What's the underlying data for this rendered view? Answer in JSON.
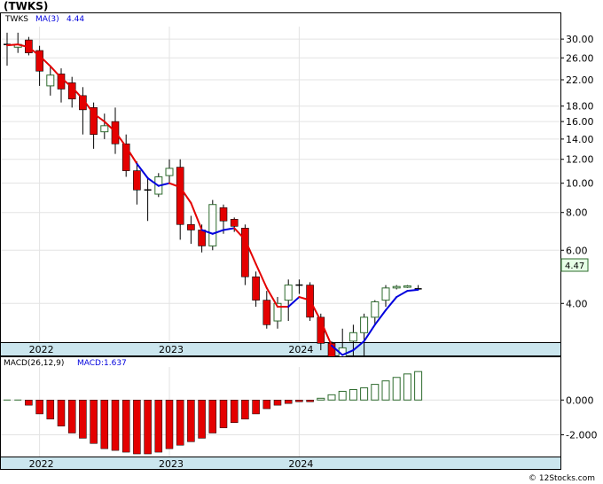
{
  "title": "(TWKS)",
  "price_panel": {
    "ticker_label": "TWKS",
    "ma_label": "MA(3)",
    "ma_value": "4.44",
    "last_price_badge": "4.47",
    "y_ticks": [
      "30.00",
      "26.00",
      "22.00",
      "18.00",
      "16.00",
      "14.00",
      "12.00",
      "10.00",
      "8.00",
      "6.00",
      "4.00"
    ],
    "x_ticks": [
      "2022",
      "2023",
      "2024"
    ]
  },
  "macd_panel": {
    "label": "MACD(26,12,9)",
    "value_label": "MACD:1.637",
    "y_ticks": [
      "0.000",
      "-2.000"
    ],
    "x_ticks": [
      "2022",
      "2023",
      "2024"
    ]
  },
  "watermark": "© 12Stocks.com",
  "colors": {
    "down": "#e40000",
    "up_fill": "#ffffff",
    "up_border": "#2e6b2e",
    "ma_down": "#e40000",
    "ma_up": "#0000dd",
    "macd_neg": "#e40000",
    "macd_pos": "#2e6b2e",
    "axis_band": "#cbe6ee",
    "badge_bg": "#e6ffe6"
  },
  "chart_data": {
    "type": "candlestick",
    "scale": "log",
    "ylim": [
      3.1,
      33
    ],
    "candles": [
      {
        "o": 28.6,
        "h": 31.5,
        "l": 24.5,
        "c": 28.8,
        "dir": "flat"
      },
      {
        "o": 28.2,
        "h": 31.5,
        "l": 27.0,
        "c": 28.8,
        "dir": "up"
      },
      {
        "o": 29.8,
        "h": 30.5,
        "l": 26.5,
        "c": 27.0,
        "dir": "down"
      },
      {
        "o": 27.5,
        "h": 28.5,
        "l": 21.0,
        "c": 23.5,
        "dir": "down"
      },
      {
        "o": 21.0,
        "h": 24.5,
        "l": 19.5,
        "c": 22.8,
        "dir": "up"
      },
      {
        "o": 23.0,
        "h": 24.0,
        "l": 18.5,
        "c": 20.5,
        "dir": "down"
      },
      {
        "o": 21.5,
        "h": 22.5,
        "l": 17.8,
        "c": 19.0,
        "dir": "down"
      },
      {
        "o": 19.5,
        "h": 20.8,
        "l": 14.5,
        "c": 17.5,
        "dir": "down"
      },
      {
        "o": 17.8,
        "h": 18.5,
        "l": 13.0,
        "c": 14.5,
        "dir": "down"
      },
      {
        "o": 14.8,
        "h": 17.0,
        "l": 14.0,
        "c": 15.5,
        "dir": "up"
      },
      {
        "o": 16.0,
        "h": 17.8,
        "l": 12.5,
        "c": 13.5,
        "dir": "down"
      },
      {
        "o": 13.5,
        "h": 14.5,
        "l": 10.5,
        "c": 11.0,
        "dir": "down"
      },
      {
        "o": 11.0,
        "h": 11.8,
        "l": 8.5,
        "c": 9.5,
        "dir": "down"
      },
      {
        "o": 9.5,
        "h": 10.5,
        "l": 7.5,
        "c": 9.5,
        "dir": "flat"
      },
      {
        "o": 9.2,
        "h": 10.8,
        "l": 9.0,
        "c": 10.5,
        "dir": "up"
      },
      {
        "o": 10.6,
        "h": 12.0,
        "l": 10.0,
        "c": 11.2,
        "dir": "up"
      },
      {
        "o": 11.3,
        "h": 12.0,
        "l": 6.5,
        "c": 7.3,
        "dir": "down"
      },
      {
        "o": 7.3,
        "h": 7.8,
        "l": 6.3,
        "c": 7.0,
        "dir": "down"
      },
      {
        "o": 7.0,
        "h": 7.3,
        "l": 5.9,
        "c": 6.2,
        "dir": "down"
      },
      {
        "o": 6.2,
        "h": 8.8,
        "l": 6.0,
        "c": 8.5,
        "dir": "up"
      },
      {
        "o": 8.3,
        "h": 8.5,
        "l": 6.8,
        "c": 7.5,
        "dir": "down"
      },
      {
        "o": 7.6,
        "h": 7.7,
        "l": 6.9,
        "c": 7.2,
        "dir": "down"
      },
      {
        "o": 7.1,
        "h": 7.3,
        "l": 4.6,
        "c": 4.9,
        "dir": "down"
      },
      {
        "o": 4.9,
        "h": 5.1,
        "l": 3.9,
        "c": 4.1,
        "dir": "down"
      },
      {
        "o": 4.1,
        "h": 4.4,
        "l": 3.3,
        "c": 3.4,
        "dir": "down"
      },
      {
        "o": 3.5,
        "h": 4.2,
        "l": 3.3,
        "c": 4.0,
        "dir": "up"
      },
      {
        "o": 4.1,
        "h": 4.8,
        "l": 3.5,
        "c": 4.6,
        "dir": "up"
      },
      {
        "o": 4.6,
        "h": 4.8,
        "l": 4.3,
        "c": 4.6,
        "dir": "flat"
      },
      {
        "o": 4.6,
        "h": 4.7,
        "l": 3.5,
        "c": 3.6,
        "dir": "down"
      },
      {
        "o": 3.6,
        "h": 3.7,
        "l": 2.8,
        "c": 2.95,
        "dir": "down"
      },
      {
        "o": 2.95,
        "h": 3.0,
        "l": 2.45,
        "c": 2.55,
        "dir": "down"
      },
      {
        "o": 2.55,
        "h": 3.3,
        "l": 2.45,
        "c": 2.85,
        "dir": "up"
      },
      {
        "o": 3.0,
        "h": 3.4,
        "l": 2.5,
        "c": 3.2,
        "dir": "up"
      },
      {
        "o": 3.2,
        "h": 3.7,
        "l": 2.6,
        "c": 3.6,
        "dir": "up"
      },
      {
        "o": 3.6,
        "h": 4.1,
        "l": 3.4,
        "c": 4.05,
        "dir": "up"
      },
      {
        "o": 4.1,
        "h": 4.6,
        "l": 3.9,
        "c": 4.5,
        "dir": "up"
      },
      {
        "o": 4.5,
        "h": 4.6,
        "l": 4.45,
        "c": 4.55,
        "dir": "up"
      },
      {
        "o": 4.55,
        "h": 4.6,
        "l": 4.5,
        "c": 4.57,
        "dir": "up"
      },
      {
        "o": 4.5,
        "h": 4.6,
        "l": 4.45,
        "c": 4.47,
        "dir": "flat"
      }
    ],
    "ma3": [
      28.6,
      28.8,
      28.2,
      26.4,
      24.4,
      22.3,
      20.8,
      19.0,
      17.0,
      16.0,
      14.8,
      13.2,
      11.6,
      10.4,
      9.8,
      10.0,
      9.7,
      8.6,
      7.0,
      6.8,
      7.0,
      7.1,
      6.5,
      5.4,
      4.5,
      3.9,
      3.9,
      4.2,
      4.1,
      3.5,
      2.9,
      2.7,
      2.8,
      3.0,
      3.4,
      3.8,
      4.2,
      4.4,
      4.44
    ],
    "ma_color_up_from_index": [
      13,
      14,
      15,
      19,
      20,
      21,
      27,
      31,
      32,
      33,
      34,
      35,
      36,
      37,
      38
    ],
    "macd_hist": [
      0.0,
      0.0,
      -0.3,
      -0.8,
      -1.1,
      -1.5,
      -1.9,
      -2.2,
      -2.5,
      -2.8,
      -2.9,
      -3.0,
      -3.1,
      -3.1,
      -3.0,
      -2.8,
      -2.6,
      -2.4,
      -2.2,
      -1.9,
      -1.6,
      -1.3,
      -1.1,
      -0.8,
      -0.5,
      -0.3,
      -0.2,
      -0.1,
      -0.1,
      0.1,
      0.3,
      0.5,
      0.6,
      0.7,
      0.9,
      1.1,
      1.3,
      1.5,
      1.637
    ],
    "macd_ylim": [
      -3.2,
      1.9
    ]
  }
}
